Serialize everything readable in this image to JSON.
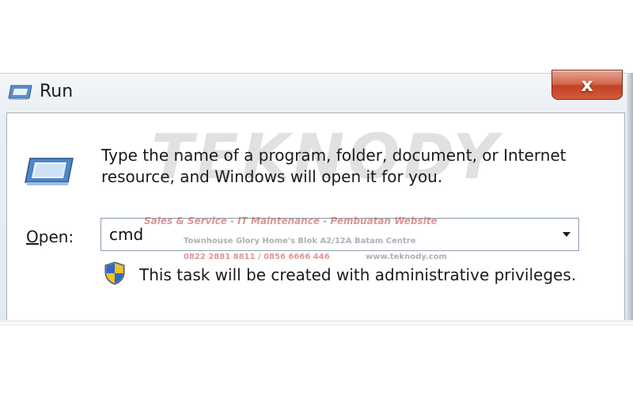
{
  "window": {
    "title": "Run",
    "icon": "run-icon",
    "close_label": "x"
  },
  "dialog": {
    "description_line1": "Type the name of a program, folder, document, or Internet",
    "description_line2": "resource, and Windows will open it for you.",
    "open_label_mnemonic": "O",
    "open_label_rest": "pen:",
    "open_value": "cmd",
    "admin_notice": "This task will be created with administrative privileges.",
    "shield_icon": "uac-shield-icon"
  },
  "watermark": {
    "brand": "TEKNODY",
    "line1": "Sales & Service - IT Maintenance - Pembuatan Website",
    "line2": "Townhouse Glory Home's Blok A2/12A Batam Centre",
    "line3_phones": "0822 2881 8811 / 0856 6666 446",
    "line3_web": "www.teknody.com"
  },
  "colors": {
    "close_button": "#c24225",
    "combo_border": "#8ea1b5",
    "watermark_red": "#c83c3c"
  }
}
